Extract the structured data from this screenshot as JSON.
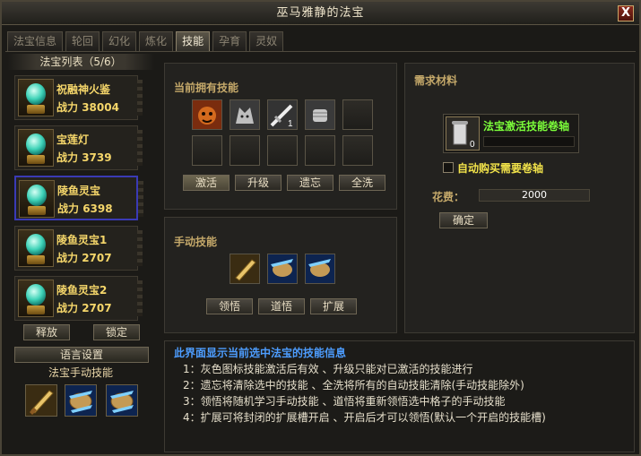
{
  "window": {
    "title": "巫马雅静的法宝",
    "close_label": "X"
  },
  "tabs": [
    {
      "label": "法宝信息",
      "active": false
    },
    {
      "label": "轮回",
      "active": false
    },
    {
      "label": "幻化",
      "active": false
    },
    {
      "label": "炼化",
      "active": false
    },
    {
      "label": "技能",
      "active": true
    },
    {
      "label": "孕育",
      "active": false
    },
    {
      "label": "灵奴",
      "active": false
    }
  ],
  "fabao_list": {
    "title": "法宝列表（5/6）",
    "power_prefix": "战力",
    "items": [
      {
        "name": "祝融神火鉴",
        "power": "38004",
        "selected": false
      },
      {
        "name": "宝莲灯",
        "power": "3739",
        "selected": false
      },
      {
        "name": "陵鱼灵宝",
        "power": "6398",
        "selected": true
      },
      {
        "name": "陵鱼灵宝1",
        "power": "2707",
        "selected": false
      },
      {
        "name": "陵鱼灵宝2",
        "power": "2707",
        "selected": false
      }
    ]
  },
  "left_buttons": {
    "release": "释放",
    "lock": "锁定",
    "language": "语言设置"
  },
  "manual_skills_label": "法宝手动技能",
  "owned_skills": {
    "title": "当前拥有技能",
    "badge": "1",
    "buttons": {
      "activate": "激活",
      "upgrade": "升级",
      "forget": "遗忘",
      "wash": "全洗"
    }
  },
  "manual": {
    "title": "手动技能",
    "buttons": {
      "comprehend": "领悟",
      "dao": "道悟",
      "expand": "扩展"
    }
  },
  "materials": {
    "title": "需求材料",
    "item_name": "法宝激活技能卷轴",
    "item_count": "0",
    "auto_buy_label": "自动购买需要卷轴",
    "cost_label": "花费：",
    "cost_value": "2000",
    "confirm": "确定"
  },
  "info": {
    "heading": "此界面显示当前选中法宝的技能信息",
    "lines": [
      "1：灰色图标技能激活后有效 、升级只能对已激活的技能进行",
      "2：遗忘将清除选中的技能 、全洗将所有的自动技能清除(手动技能除外)",
      "3：领悟将随机学习手动技能 、道悟将重新领悟选中格子的手动技能",
      "4：扩展可将封闭的扩展槽开启 、开启后才可以领悟(默认一个开启的技能槽)"
    ]
  },
  "colors": {
    "name_gold": "#f5d66a",
    "info_blue": "#4d9dff",
    "material_green": "#7cff3a",
    "selected_border": "#3a3ab5"
  },
  "icons": [
    "bear-skill-icon",
    "wolf-skill-icon",
    "sword-skill-icon",
    "fist-skill-icon",
    "blade-skill-icon",
    "shield-skill-icon",
    "scroll-icon",
    "orb-icon"
  ]
}
